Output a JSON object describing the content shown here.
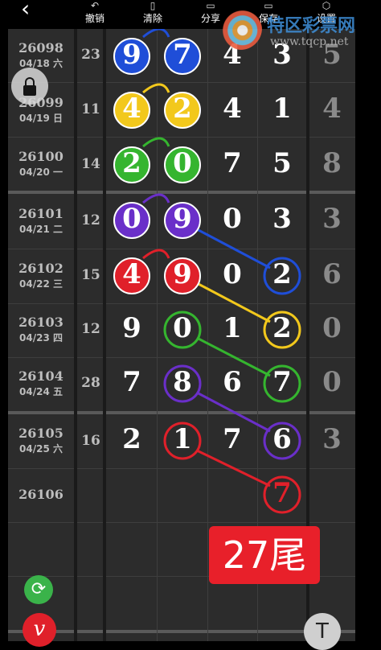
{
  "toolbar": {
    "undo": "撤销",
    "clear": "清除",
    "share": "分享",
    "save": "保存",
    "settings": "设置"
  },
  "watermark": {
    "site_name": "特区彩票网",
    "url": "www.tqcp.net"
  },
  "rows": [
    {
      "issue": "26098",
      "date": "04/18 六",
      "sum": "23",
      "digits": [
        "9",
        "7",
        "4",
        "3"
      ],
      "tail": "5"
    },
    {
      "issue": "26099",
      "date": "04/19 日",
      "sum": "11",
      "digits": [
        "4",
        "2",
        "4",
        "1"
      ],
      "tail": "4"
    },
    {
      "issue": "26100",
      "date": "04/20 一",
      "sum": "14",
      "digits": [
        "2",
        "0",
        "7",
        "5"
      ],
      "tail": "8"
    },
    {
      "issue": "26101",
      "date": "04/21 二",
      "sum": "12",
      "digits": [
        "0",
        "9",
        "0",
        "3"
      ],
      "tail": "3"
    },
    {
      "issue": "26102",
      "date": "04/22 三",
      "sum": "15",
      "digits": [
        "4",
        "9",
        "0",
        "2"
      ],
      "tail": "6"
    },
    {
      "issue": "26103",
      "date": "04/23 四",
      "sum": "12",
      "digits": [
        "9",
        "0",
        "1",
        "2"
      ],
      "tail": "0"
    },
    {
      "issue": "26104",
      "date": "04/24 五",
      "sum": "28",
      "digits": [
        "7",
        "8",
        "6",
        "7"
      ],
      "tail": "0"
    },
    {
      "issue": "26105",
      "date": "04/25 六",
      "sum": "16",
      "digits": [
        "2",
        "1",
        "7",
        "6"
      ],
      "tail": "3"
    },
    {
      "issue": "26106",
      "date": "",
      "sum": "",
      "digits": [
        "",
        "",
        "",
        "7"
      ],
      "tail": ""
    }
  ],
  "banner_text": "27尾",
  "colors": {
    "blue": "#1f4ed8",
    "yellow": "#f2c81c",
    "green": "#35b52f",
    "purple": "#6a2fc9",
    "red": "#e0202a"
  },
  "icons": {
    "back": "chevron-left-icon",
    "lock": "lock-icon",
    "refresh": "refresh-icon",
    "pen": "pen-icon",
    "text": "text-icon"
  }
}
